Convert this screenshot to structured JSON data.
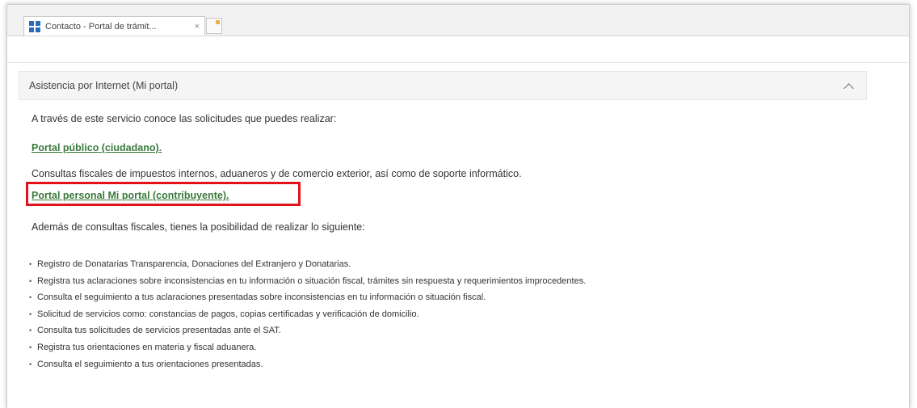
{
  "browser": {
    "tab_title": "Contacto - Portal de trámit...",
    "tab_close": "×"
  },
  "section": {
    "title": "Asistencia por Internet (Mi portal)",
    "expanded": true,
    "intro": "A través de este servicio conoce las solicitudes que puedes realizar:",
    "link_public": "Portal público (ciudadano).",
    "public_desc": "Consultas fiscales de impuestos internos, aduaneros y de comercio exterior, así como de soporte informático.",
    "link_personal": "Portal personal Mi portal (contribuyente).",
    "personal_desc": "Además de consultas fiscales, tienes la posibilidad de realizar lo siguiente:",
    "items": [
      "Registro de Donatarias Transparencia, Donaciones del Extranjero y Donatarias.",
      "Registra tus aclaraciones sobre inconsistencias en tu información o situación fiscal, trámites sin respuesta y requerimientos improcedentes.",
      "Consulta el seguimiento a tus aclaraciones presentadas sobre inconsistencias en tu información o situación fiscal.",
      "Solicitud de servicios como: constancias de pagos, copias certificadas y verificación de domicilio.",
      "Consulta tus solicitudes de servicios presentadas ante el SAT.",
      "Registra tus orientaciones en materia y fiscal aduanera.",
      "Consulta el seguimiento a tus orientaciones presentadas."
    ]
  },
  "colors": {
    "link": "#3a7a3a",
    "highlight_box": "#e0121a",
    "header_bg": "#f5f5f5"
  }
}
